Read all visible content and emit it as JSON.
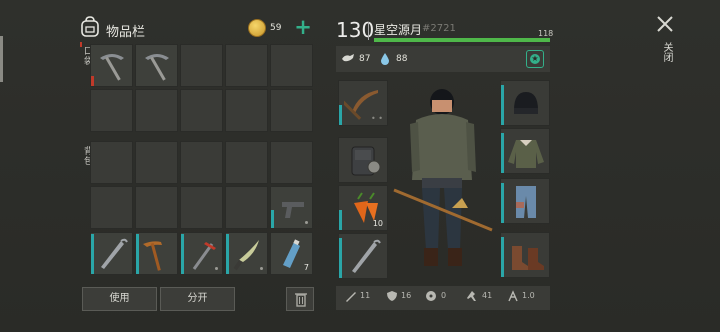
{
  "inventory": {
    "title": "物品栏",
    "coins": "59",
    "add_label": "+",
    "pocket_label": "口袋",
    "backpack_label": "背包",
    "pocket_slots": [
      {
        "item": "pickaxe-icon",
        "count": "",
        "bar": "red"
      },
      {
        "item": "pickaxe-icon",
        "count": "",
        "bar": ""
      }
    ],
    "backpack_slots": [
      {
        "item": "pistol-icon",
        "count": "",
        "bar": "teal"
      },
      {
        "item": "crowbar-icon",
        "count": "",
        "bar": "teal"
      },
      {
        "item": "hockey-stick-icon",
        "count": "",
        "bar": "teal"
      },
      {
        "item": "hammer-crowbar-icon",
        "count": "",
        "bar": "teal"
      },
      {
        "item": "machete-icon",
        "count": "",
        "bar": "teal"
      },
      {
        "item": "water-bottle-icon",
        "count": "7",
        "bar": ""
      }
    ],
    "buttons": {
      "use": "使用",
      "split": "分开"
    }
  },
  "character": {
    "level": "130",
    "name": "星空源月",
    "id": "#2721",
    "hp": "118",
    "food": "87",
    "water": "88",
    "left_equip": [
      {
        "item": "pickaxe-icon",
        "count": ""
      },
      {
        "item": "backpack-icon",
        "count": ""
      },
      {
        "item": "carrot-icon",
        "count": "10"
      },
      {
        "item": "crowbar-icon",
        "count": ""
      }
    ],
    "right_equip": [
      {
        "item": "beanie-icon"
      },
      {
        "item": "jacket-icon"
      },
      {
        "item": "pants-icon"
      },
      {
        "item": "boots-icon"
      }
    ],
    "stats": {
      "attack": "11",
      "defense": "16",
      "radiation": "0",
      "speed": "41",
      "stealth": "1.0"
    }
  },
  "close_label": "关闭",
  "colors": {
    "accent": "#33b08a",
    "hp": "#4fb84a",
    "durability": "#2aa6a8",
    "warning": "#c03a2a"
  }
}
